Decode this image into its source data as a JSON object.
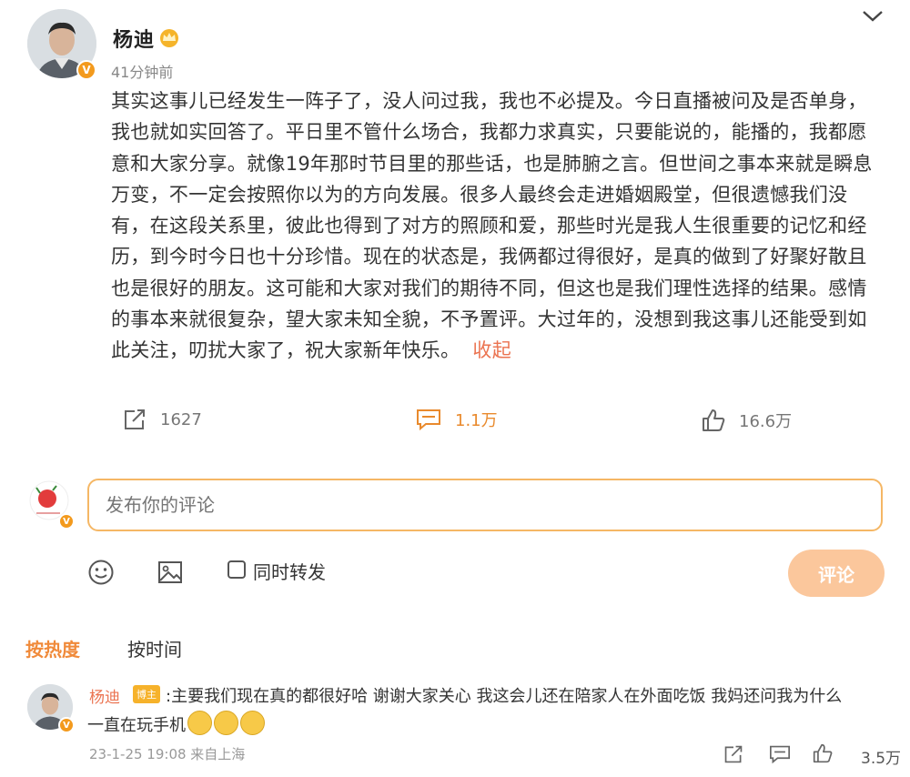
{
  "post": {
    "author": "杨迪",
    "time": "41分钟前",
    "body": "其实这事儿已经发生一阵子了，没人问过我，我也不必提及。今日直播被问及是否单身，我也就如实回答了。平日里不管什么场合，我都力求真实，只要能说的，能播的，我都愿意和大家分享。就像19年那时节目里的那些话，也是肺腑之言。但世间之事本来就是瞬息万变，不一定会按照你以为的方向发展。很多人最终会走进婚姻殿堂，但很遗憾我们没有，在这段关系里，彼此也得到了对方的照顾和爱，那些时光是我人生很重要的记忆和经历，到今时今日也十分珍惜。现在的状态是，我俩都过得很好，是真的做到了好聚好散且也是很好的朋友。这可能和大家对我们的期待不同，但这也是我们理性选择的结果。感情的事本来就很复杂，望大家未知全貌，不予置评。大过年的，没想到我这事儿还能受到如此关注，叨扰大家了，祝大家新年快乐。",
    "collapse_label": "收起",
    "reposts": "1627",
    "comments": "1.1万",
    "likes": "16.6万"
  },
  "composer": {
    "placeholder": "发布你的评论",
    "repost_label": "同时转发",
    "submit_label": "评论"
  },
  "sort": {
    "hot": "按热度",
    "time": "按时间"
  },
  "comment": {
    "author": "杨迪",
    "badge": "博主",
    "text_line1": ":主要我们现在真的都很好哈 谢谢大家关心 我这会儿还在陪家人在外面吃饭 我妈还问我为什么",
    "text_line2": "一直在玩手机",
    "meta": "23-1-25 19:08 来自上海",
    "likes": "3.5万"
  },
  "colors": {
    "accent": "#eb7350",
    "orange": "#f08a3a",
    "input_border": "#f5b765",
    "submit_bg": "#fbc79c"
  },
  "icons": [
    "chevron-down-icon",
    "crown-icon",
    "verified-icon",
    "repost-icon",
    "comment-icon",
    "like-icon",
    "emoji-icon",
    "image-icon",
    "cry-emoji-icon"
  ]
}
